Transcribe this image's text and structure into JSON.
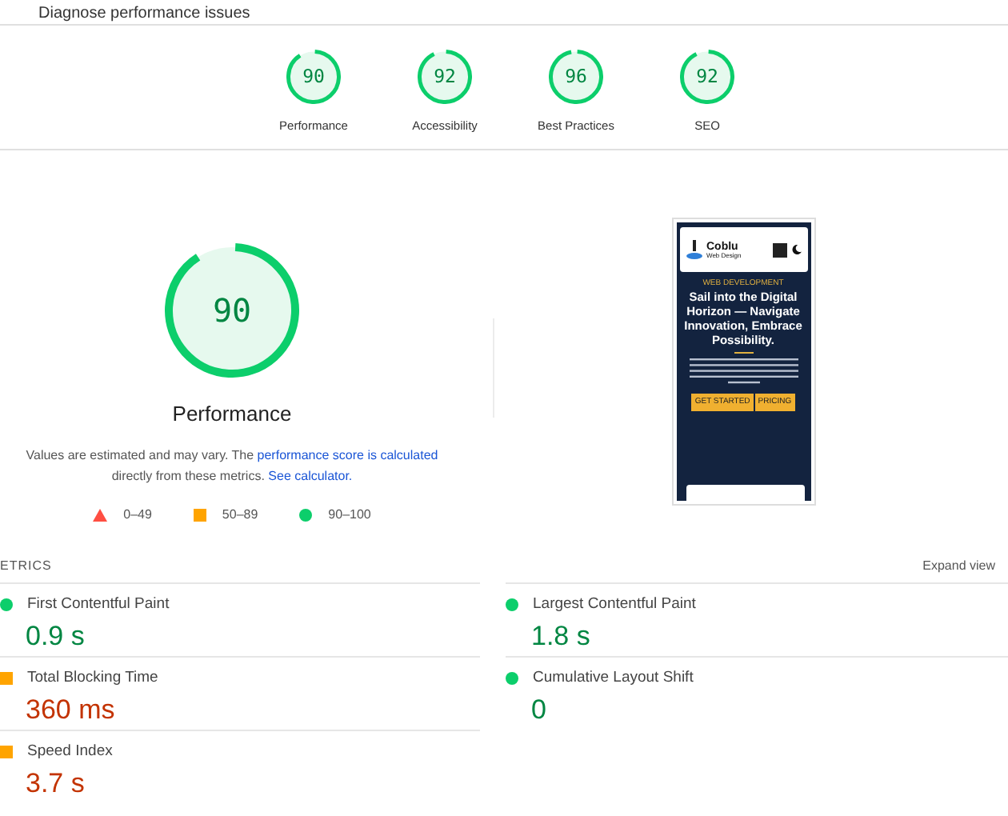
{
  "header": {
    "title": "Diagnose performance issues"
  },
  "gauges": [
    {
      "score": "90",
      "label": "Performance"
    },
    {
      "score": "92",
      "label": "Accessibility"
    },
    {
      "score": "96",
      "label": "Best Practices"
    },
    {
      "score": "92",
      "label": "SEO"
    }
  ],
  "main_gauge": {
    "score": "90",
    "label": "Performance"
  },
  "note": {
    "before": "Values are estimated and may vary. The ",
    "link1": "performance score is calculated",
    "middle": "directly from these metrics.",
    "link2": "See calculator."
  },
  "legend": [
    {
      "kind": "fail",
      "range": "0–49"
    },
    {
      "kind": "average",
      "range": "50–89"
    },
    {
      "kind": "pass",
      "range": "90–100"
    }
  ],
  "preview": {
    "brand": "Coblu",
    "brand_sub": "Web Design",
    "eyebrow": "WEB DEVELOPMENT",
    "headline": "Sail into the Digital Horizon — Navigate Innovation, Embrace Possibility.",
    "buttons": [
      "GET STARTED",
      "PRICING"
    ]
  },
  "metrics_header": {
    "title": "ETRICS",
    "expand": "Expand view"
  },
  "metrics": [
    {
      "name": "First Contentful Paint",
      "value": "0.9 s",
      "kind": "pass"
    },
    {
      "name": "Largest Contentful Paint",
      "value": "1.8 s",
      "kind": "pass"
    },
    {
      "name": "Total Blocking Time",
      "value": "360 ms",
      "kind": "average"
    },
    {
      "name": "Cumulative Layout Shift",
      "value": "0",
      "kind": "pass"
    },
    {
      "name": "Speed Index",
      "value": "3.7 s",
      "kind": "average"
    }
  ]
}
